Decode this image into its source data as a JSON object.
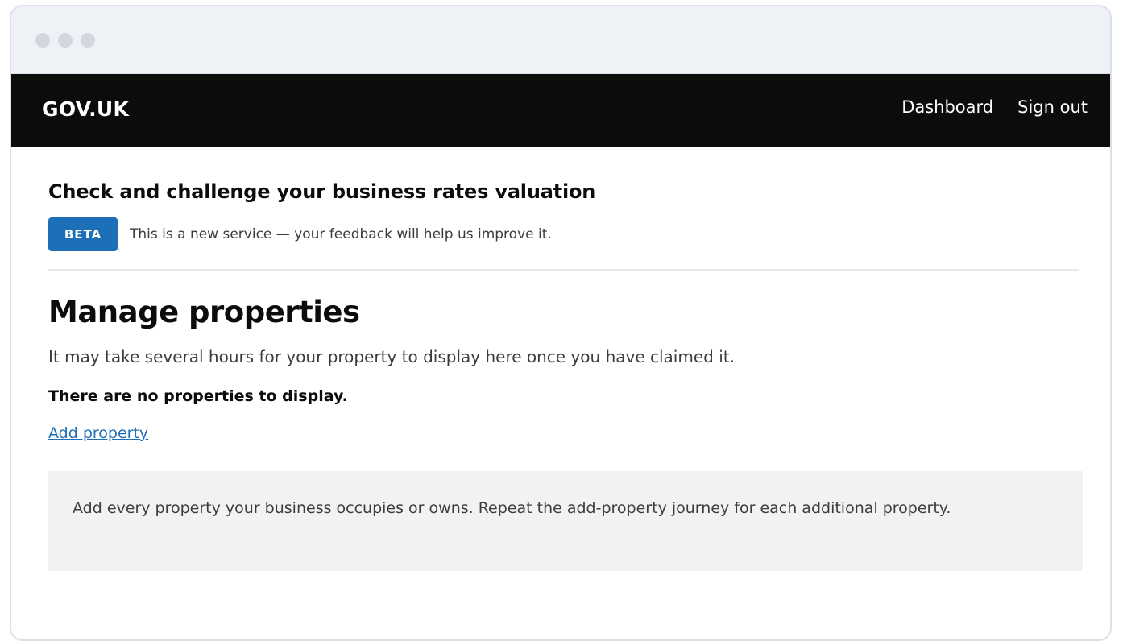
{
  "header": {
    "logo": "GOV.UK",
    "nav": [
      {
        "label": "Dashboard"
      },
      {
        "label": "Sign out"
      }
    ]
  },
  "service": {
    "name": "Check and challenge your business rates valuation",
    "phase_tag": "BETA",
    "phase_text": "This is a new service — your feedback will help us improve it."
  },
  "main": {
    "title": "Manage properties",
    "intro": "It may take several hours for your property to display here once you have claimed it.",
    "empty_message": "There are no properties to display.",
    "add_link": "Add property",
    "inset_text": "Add every property your business occupies or owns. Repeat the add-property journey for each additional property."
  },
  "colors": {
    "header_bg": "#0b0c0c",
    "tag_blue": "#1d70b8",
    "link_blue": "#1d70b8",
    "inset_bg": "#f3f2f1"
  }
}
